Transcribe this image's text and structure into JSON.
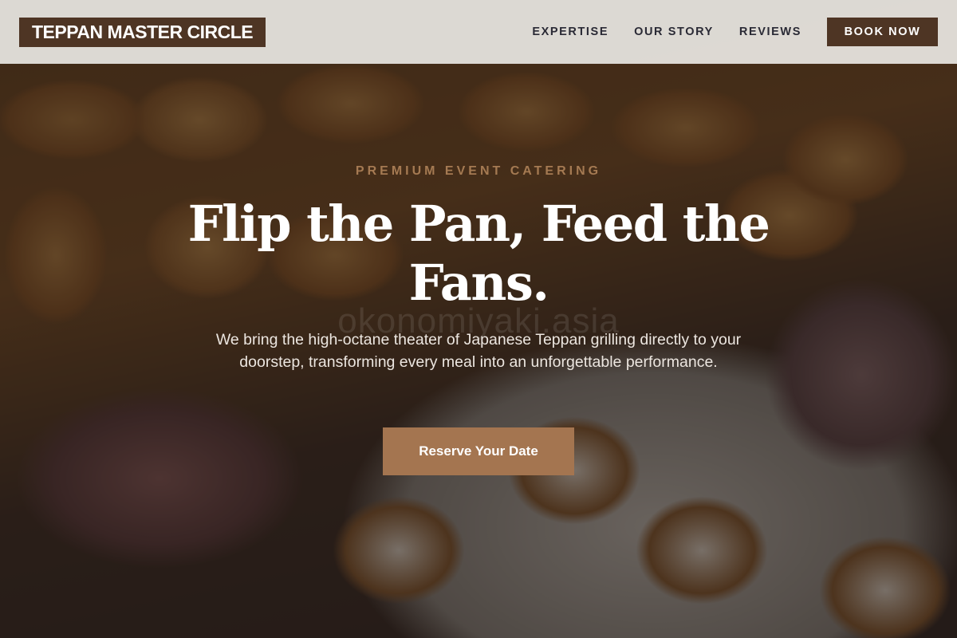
{
  "header": {
    "brand": "TEPPAN MASTER CIRCLE",
    "nav": [
      {
        "label": "EXPERTISE"
      },
      {
        "label": "OUR STORY"
      },
      {
        "label": "REVIEWS"
      }
    ],
    "book_label": "BOOK NOW"
  },
  "hero": {
    "eyebrow": "PREMIUM EVENT CATERING",
    "headline": "Flip the Pan, Feed the Fans.",
    "subtext": "We bring the high-octane theater of Japanese Teppan grilling directly to your doorstep, transforming every meal into an unforgettable performance.",
    "cta_label": "Reserve Your Date",
    "watermark": "okonomiyaki.asia"
  },
  "colors": {
    "brand_brown": "#4e3524",
    "accent_tan": "#a47550",
    "eyebrow_tan": "#a57a52",
    "header_bg": "#e8e6e2"
  }
}
